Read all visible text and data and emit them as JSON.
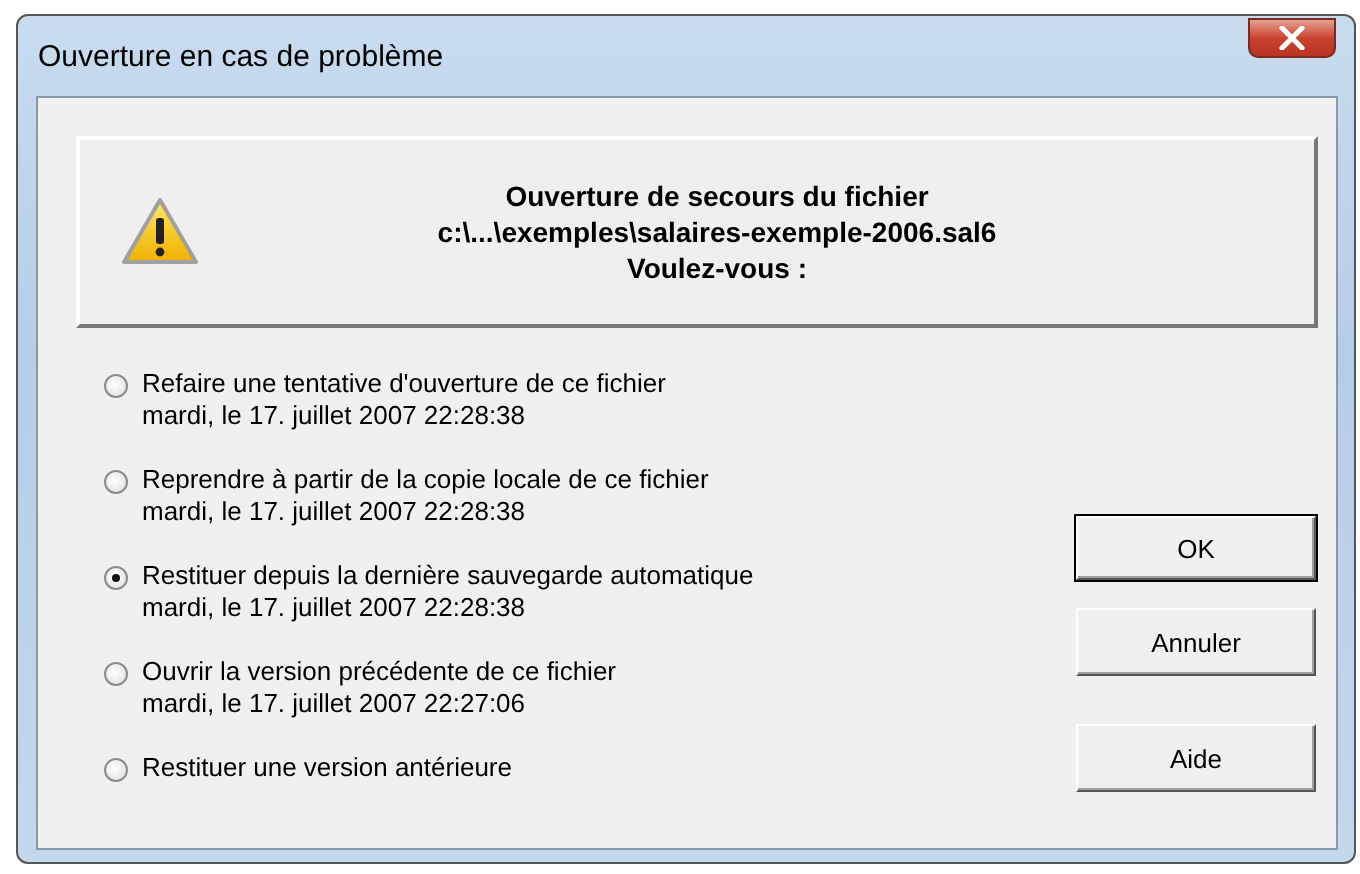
{
  "window": {
    "title": "Ouverture en cas de problème"
  },
  "header": {
    "lines": [
      "Ouverture de secours du fichier",
      "c:\\...\\exemples\\salaires-exemple-2006.sal6",
      "Voulez-vous :"
    ]
  },
  "options": [
    {
      "label": "Refaire une tentative d'ouverture de ce fichier",
      "detail": "mardi, le 17. juillet 2007 22:28:38",
      "selected": false
    },
    {
      "label": "Reprendre à partir de la copie locale de ce fichier",
      "detail": "mardi, le 17. juillet 2007 22:28:38",
      "selected": false
    },
    {
      "label": "Restituer depuis la dernière sauvegarde automatique",
      "detail": "mardi, le 17. juillet 2007 22:28:38",
      "selected": true
    },
    {
      "label": "Ouvrir la version précédente de ce fichier",
      "detail": "mardi, le 17. juillet 2007 22:27:06",
      "selected": false
    },
    {
      "label": "Restituer une version antérieure",
      "selected": false
    }
  ],
  "buttons": [
    {
      "label": "OK",
      "default": true
    },
    {
      "label": "Annuler",
      "default": false
    },
    {
      "label": "Aide",
      "default": false
    }
  ]
}
